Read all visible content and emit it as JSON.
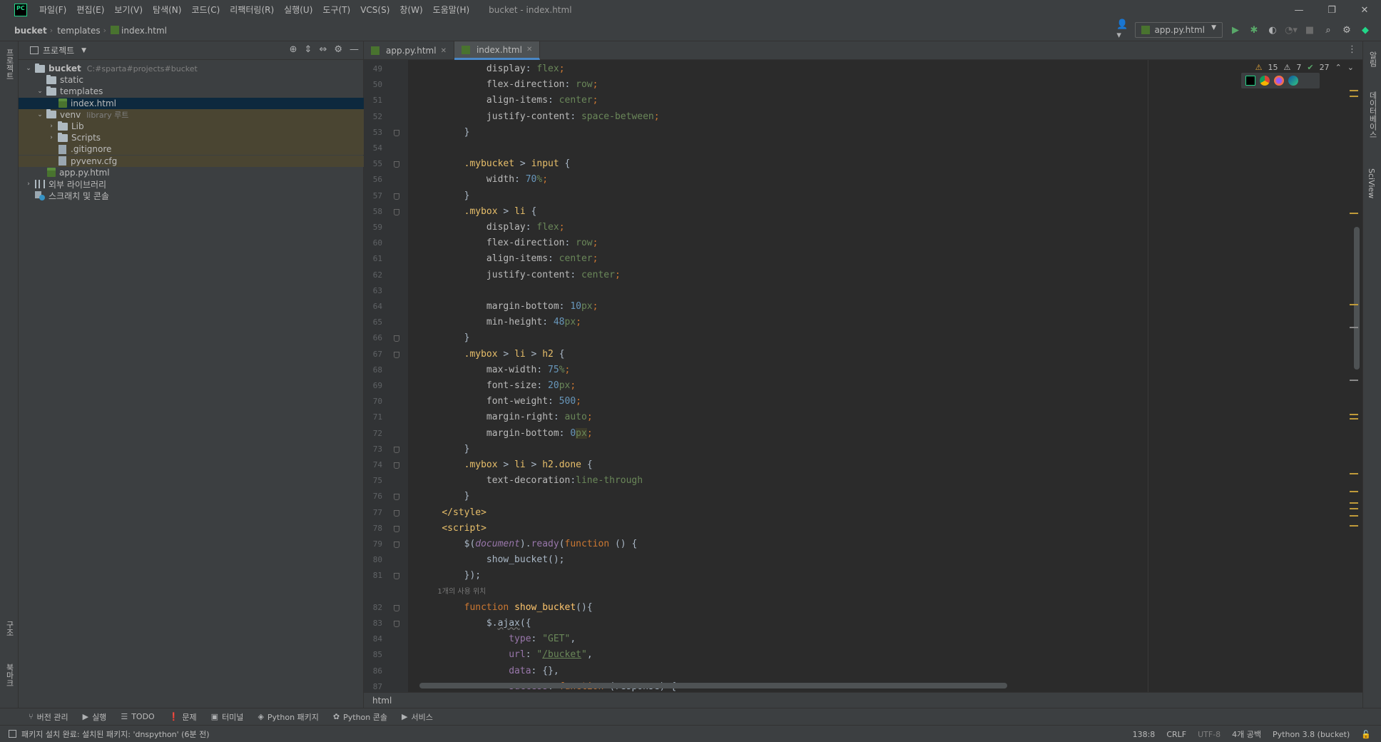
{
  "window": {
    "title": "bucket - index.html",
    "menu": [
      "파일(F)",
      "편집(E)",
      "보기(V)",
      "탐색(N)",
      "코드(C)",
      "리팩터링(R)",
      "실행(U)",
      "도구(T)",
      "VCS(S)",
      "창(W)",
      "도움말(H)"
    ],
    "logo_text": "PC"
  },
  "navbar": {
    "breadcrumbs": [
      "bucket",
      "templates",
      "index.html"
    ],
    "run_config": "app.py.html"
  },
  "left_strip": {
    "top_label": "프로젝트",
    "middle_label": "구조",
    "bottom_label": "북마크"
  },
  "right_strip": {
    "labels": [
      "알림",
      "데이터베이스",
      "SciView"
    ]
  },
  "project": {
    "title": "프로젝트",
    "tree": [
      {
        "label": "bucket",
        "hint": "C:#sparta#projects#bucket",
        "kind": "folder",
        "depth": 0,
        "expanded": true
      },
      {
        "label": "static",
        "hint": "",
        "kind": "folder",
        "depth": 1,
        "expanded": false
      },
      {
        "label": "templates",
        "hint": "",
        "kind": "folder",
        "depth": 1,
        "expanded": true
      },
      {
        "label": "index.html",
        "hint": "",
        "kind": "html",
        "depth": 2,
        "selected": true
      },
      {
        "label": "venv",
        "hint": "library 루트",
        "kind": "folder",
        "depth": 1,
        "expanded": true,
        "venv": true
      },
      {
        "label": "Lib",
        "hint": "",
        "kind": "folder",
        "depth": 2,
        "collapsed": true,
        "venv": true
      },
      {
        "label": "Scripts",
        "hint": "",
        "kind": "folder",
        "depth": 2,
        "collapsed": true,
        "venv": true
      },
      {
        "label": ".gitignore",
        "hint": "",
        "kind": "file",
        "depth": 2,
        "venv": true
      },
      {
        "label": "pyvenv.cfg",
        "hint": "",
        "kind": "file",
        "depth": 2,
        "venv": true
      },
      {
        "label": "app.py.html",
        "hint": "",
        "kind": "html",
        "depth": 1
      },
      {
        "label": "외부 라이브러리",
        "hint": "",
        "kind": "lib",
        "depth": 0,
        "collapsed": true
      },
      {
        "label": "스크래치 및 콘솔",
        "hint": "",
        "kind": "scratch",
        "depth": 0
      }
    ]
  },
  "editor": {
    "tabs": [
      {
        "label": "app.py.html",
        "active": false
      },
      {
        "label": "index.html",
        "active": true
      }
    ],
    "inspections": {
      "warnings": "15",
      "weak_warnings": "7",
      "ok": "27"
    },
    "footer": "html",
    "lines": [
      {
        "num": "49",
        "html": "            <span class='prop'>display</span>: <span class='val'>flex</span><span class='kw'>;</span>"
      },
      {
        "num": "50",
        "html": "            <span class='prop'>flex-direction</span>: <span class='val'>row</span><span class='kw'>;</span>"
      },
      {
        "num": "51",
        "html": "            <span class='prop'>align-items</span>: <span class='val'>center</span><span class='kw'>;</span>"
      },
      {
        "num": "52",
        "html": "            <span class='prop'>justify-content</span>: <span class='val'>space-between</span><span class='kw'>;</span>"
      },
      {
        "num": "53",
        "html": "        }"
      },
      {
        "num": "54",
        "html": ""
      },
      {
        "num": "55",
        "html": "        <span class='cls'>.mybucket</span> > <span class='cls'>input</span> {"
      },
      {
        "num": "56",
        "html": "            <span class='prop'>width</span>: <span class='num'>70</span><span class='val'>%</span><span class='kw'>;</span>"
      },
      {
        "num": "57",
        "html": "        }"
      },
      {
        "num": "58",
        "html": "        <span class='cls'>.mybox</span> > <span class='cls'>li</span> {"
      },
      {
        "num": "59",
        "html": "            <span class='prop'>display</span>: <span class='val'>flex</span><span class='kw'>;</span>"
      },
      {
        "num": "60",
        "html": "            <span class='prop'>flex-direction</span>: <span class='val'>row</span><span class='kw'>;</span>"
      },
      {
        "num": "61",
        "html": "            <span class='prop'>align-items</span>: <span class='val'>center</span><span class='kw'>;</span>"
      },
      {
        "num": "62",
        "html": "            <span class='prop'>justify-content</span>: <span class='val'>center</span><span class='kw'>;</span>"
      },
      {
        "num": "63",
        "html": ""
      },
      {
        "num": "64",
        "html": "            <span class='prop'>margin-bottom</span>: <span class='num'>10</span><span class='val'>px</span><span class='kw'>;</span>"
      },
      {
        "num": "65",
        "html": "            <span class='prop'>min-height</span>: <span class='num'>48</span><span class='val'>px</span><span class='kw'>;</span>"
      },
      {
        "num": "66",
        "html": "        }"
      },
      {
        "num": "67",
        "html": "        <span class='cls'>.mybox</span> > <span class='cls'>li</span> > <span class='cls'>h2</span> {"
      },
      {
        "num": "68",
        "html": "            <span class='prop'>max-width</span>: <span class='num'>75</span><span class='val'>%</span><span class='kw'>;</span>"
      },
      {
        "num": "69",
        "html": "            <span class='prop'>font-size</span>: <span class='num'>20</span><span class='val'>px</span><span class='kw'>;</span>"
      },
      {
        "num": "70",
        "html": "            <span class='prop'>font-weight</span>: <span class='num'>500</span><span class='kw'>;</span>"
      },
      {
        "num": "71",
        "html": "            <span class='prop'>margin-right</span>: <span class='val'>auto</span><span class='kw'>;</span>"
      },
      {
        "num": "72",
        "html": "            <span class='prop'>margin-bottom</span>: <span class='num'>0</span><span class='val' style='background:#3b3a2a'>px</span><span class='kw'>;</span>"
      },
      {
        "num": "73",
        "html": "        }"
      },
      {
        "num": "74",
        "html": "        <span class='cls'>.mybox</span> > <span class='cls'>li</span> > <span class='cls'>h2.done</span> {"
      },
      {
        "num": "75",
        "html": "            <span class='prop'>text-decoration</span>:<span class='val'>line-through</span>"
      },
      {
        "num": "76",
        "html": "        }"
      },
      {
        "num": "77",
        "html": "    <span class='tagc'>&lt;/style&gt;</span>"
      },
      {
        "num": "78",
        "html": "    <span class='tagc'>&lt;script&gt;</span>"
      },
      {
        "num": "79",
        "html": "        <span class='plain'>$(</span><span class='doc'>document</span><span class='plain'>).</span><span class='fn' style='color:#9876aa;font-style:normal'>ready</span><span class='plain'>(</span><span class='kw'>function</span> () {"
      },
      {
        "num": "80",
        "html": "            <span class='plain'>show_bucket();</span>"
      },
      {
        "num": "81",
        "html": "        });"
      },
      {
        "num": "",
        "hint": "        1개의 사용 위치"
      },
      {
        "num": "82",
        "html": "        <span class='kw'>function</span> <span class='fn'>show_bucket</span>(){"
      },
      {
        "num": "83",
        "html": "            <span class='plain'>$.</span><span class='plain' style='text-decoration:underline wavy #707070'>ajax</span>({"
      },
      {
        "num": "84",
        "html": "                <span class='doc' style='font-style:normal'>type</span>: <span class='str'>\"GET\"</span>,"
      },
      {
        "num": "85",
        "html": "                <span class='doc' style='font-style:normal'>url</span>: <span class='str'>\"</span><span class='strlink'>/bucket</span><span class='str'>\"</span>,"
      },
      {
        "num": "86",
        "html": "                <span class='doc' style='font-style:normal'>data</span>: {},"
      },
      {
        "num": "87",
        "html": "                <span class='doc' style='font-style:normal'>success</span>: <span class='kw'>function</span> (response) {"
      }
    ]
  },
  "toolwindows": [
    {
      "label": "버전 관리",
      "icon": "branch-icon",
      "glyph": "⑂"
    },
    {
      "label": "실행",
      "icon": "run-icon",
      "glyph": "▶"
    },
    {
      "label": "TODO",
      "icon": "todo-icon",
      "glyph": "☰"
    },
    {
      "label": "문제",
      "icon": "problems-icon",
      "glyph": "❗"
    },
    {
      "label": "터미널",
      "icon": "terminal-icon",
      "glyph": "▣"
    },
    {
      "label": "Python 패키지",
      "icon": "packages-icon",
      "glyph": "◈"
    },
    {
      "label": "Python 콘솔",
      "icon": "console-icon",
      "glyph": "✿"
    },
    {
      "label": "서비스",
      "icon": "services-icon",
      "glyph": "▶"
    }
  ],
  "status": {
    "message": "패키지 설치 완료: 설치된 패키지: 'dnspython' (6분 전)",
    "position": "138:8",
    "line_sep": "CRLF",
    "encoding": "UTF-8",
    "indent": "4개 공백",
    "interpreter": "Python 3.8 (bucket)"
  },
  "colors": {
    "accent": "#4a88c7",
    "run_green": "#59a869",
    "warn": "#e2a43a"
  }
}
